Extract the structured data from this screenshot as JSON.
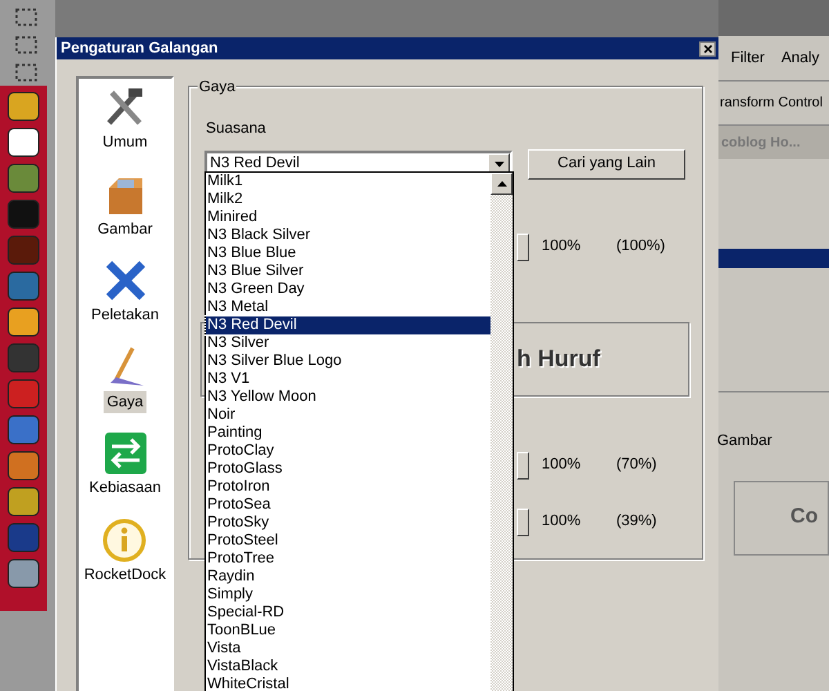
{
  "background_app": {
    "menu": [
      "Filter",
      "Analy"
    ],
    "toolbar_text": "ransform Control",
    "tab": "coblog Ho...",
    "section_label": "Gambar",
    "preview_text": "Co"
  },
  "window": {
    "title": "Pengaturan Galangan"
  },
  "sidebar": {
    "items": [
      {
        "label": "Umum",
        "selected": false
      },
      {
        "label": "Gambar",
        "selected": false
      },
      {
        "label": "Peletakan",
        "selected": false
      },
      {
        "label": "Gaya",
        "selected": true
      },
      {
        "label": "Kebiasaan",
        "selected": false
      },
      {
        "label": "RocketDock",
        "selected": false
      }
    ]
  },
  "group": {
    "title": "Gaya",
    "theme_label": "Suasana",
    "theme_value": "N3 Red Devil",
    "find_button": "Cari yang Lain",
    "font_preview": "h Huruf",
    "sliders": [
      {
        "level": 1,
        "value": "100%",
        "reading": "(100%)"
      },
      {
        "level": 1,
        "value": "100%",
        "reading": "(70%)"
      },
      {
        "level": 1,
        "value": "100%",
        "reading": "(39%)"
      }
    ],
    "dropdown": {
      "items": [
        {
          "label": "Milk1",
          "selected": false
        },
        {
          "label": "Milk2",
          "selected": false
        },
        {
          "label": "Minired",
          "selected": false
        },
        {
          "label": "N3 Black Silver",
          "selected": false
        },
        {
          "label": "N3 Blue Blue",
          "selected": false
        },
        {
          "label": "N3 Blue Silver",
          "selected": false
        },
        {
          "label": "N3 Green Day",
          "selected": false
        },
        {
          "label": "N3 Metal",
          "selected": false
        },
        {
          "label": "N3 Red Devil",
          "selected": true
        },
        {
          "label": "N3 Silver",
          "selected": false
        },
        {
          "label": "N3 Silver Blue Logo",
          "selected": false
        },
        {
          "label": "N3 V1",
          "selected": false
        },
        {
          "label": "N3 Yellow Moon",
          "selected": false
        },
        {
          "label": "Noir",
          "selected": false
        },
        {
          "label": "Painting",
          "selected": false
        },
        {
          "label": "ProtoClay",
          "selected": false
        },
        {
          "label": "ProtoGlass",
          "selected": false
        },
        {
          "label": "ProtoIron",
          "selected": false
        },
        {
          "label": "ProtoSea",
          "selected": false
        },
        {
          "label": "ProtoSky",
          "selected": false
        },
        {
          "label": "ProtoSteel",
          "selected": false
        },
        {
          "label": "ProtoTree",
          "selected": false
        },
        {
          "label": "Raydin",
          "selected": false
        },
        {
          "label": "Simply",
          "selected": false
        },
        {
          "label": "Special-RD",
          "selected": false
        },
        {
          "label": "ToonBLue",
          "selected": false
        },
        {
          "label": "Vista",
          "selected": false
        },
        {
          "label": "VistaBlack",
          "selected": false
        },
        {
          "label": "WhiteCristal",
          "selected": false
        }
      ]
    }
  }
}
